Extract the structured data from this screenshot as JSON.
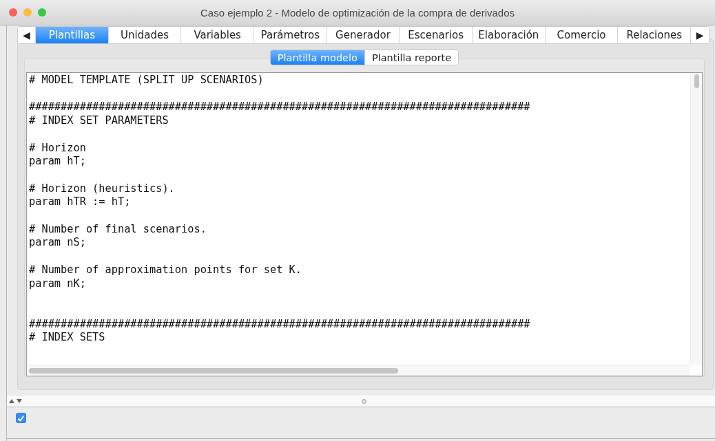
{
  "window": {
    "title": "Caso ejemplo 2 - Modelo de optimización de la compra de derivados"
  },
  "tabs": {
    "prev": "◀",
    "next": "▶",
    "items": [
      {
        "label": "Plantillas",
        "selected": true
      },
      {
        "label": "Unidades",
        "selected": false
      },
      {
        "label": "Variables",
        "selected": false
      },
      {
        "label": "Parámetros",
        "selected": false
      },
      {
        "label": "Generador",
        "selected": false
      },
      {
        "label": "Escenarios",
        "selected": false
      },
      {
        "label": "Elaboración",
        "selected": false
      },
      {
        "label": "Comercio",
        "selected": false
      },
      {
        "label": "Relaciones",
        "selected": false
      }
    ]
  },
  "subtabs": [
    {
      "label": "Plantilla modelo",
      "selected": true
    },
    {
      "label": "Plantilla reporte",
      "selected": false
    }
  ],
  "editor": {
    "text": "# MODEL TEMPLATE (SPLIT UP SCENARIOS)\n\n###############################################################################\n# INDEX SET PARAMETERS\n\n# Horizon\nparam hT;\n\n# Horizon (heuristics).\nparam hTR := hT;\n\n# Number of final scenarios.\nparam nS;\n\n# Number of approximation points for set K.\nparam nK;\n\n\n###############################################################################\n# INDEX SETS"
  },
  "bottom_panel": {
    "checked": true
  }
}
